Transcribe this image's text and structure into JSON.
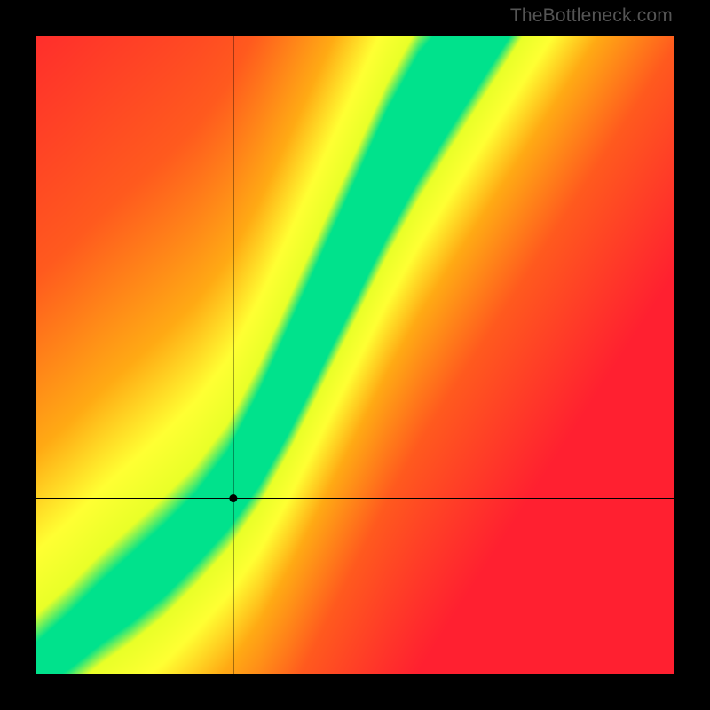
{
  "watermark": "TheBottleneck.com",
  "chart_data": {
    "type": "heatmap",
    "title": "",
    "xlabel": "",
    "ylabel": "",
    "xlim": [
      0,
      100
    ],
    "ylim": [
      0,
      100
    ],
    "crosshair": {
      "x": 30.9,
      "y": 27.5
    },
    "green_band": [
      {
        "x": 0.0,
        "lo": 0.0,
        "hi": 1.5
      },
      {
        "x": 5.0,
        "lo": 3.0,
        "hi": 6.0
      },
      {
        "x": 10.0,
        "lo": 7.0,
        "hi": 11.0
      },
      {
        "x": 15.0,
        "lo": 10.5,
        "hi": 15.5
      },
      {
        "x": 20.0,
        "lo": 14.5,
        "hi": 20.0
      },
      {
        "x": 25.0,
        "lo": 19.5,
        "hi": 25.0
      },
      {
        "x": 30.0,
        "lo": 25.0,
        "hi": 31.5
      },
      {
        "x": 35.0,
        "lo": 32.0,
        "hi": 41.0
      },
      {
        "x": 40.0,
        "lo": 41.0,
        "hi": 52.0
      },
      {
        "x": 45.0,
        "lo": 51.0,
        "hi": 63.0
      },
      {
        "x": 50.0,
        "lo": 61.0,
        "hi": 74.0
      },
      {
        "x": 55.0,
        "lo": 71.0,
        "hi": 85.0
      },
      {
        "x": 60.0,
        "lo": 80.0,
        "hi": 94.0
      },
      {
        "x": 65.0,
        "lo": 88.0,
        "hi": 100.0
      },
      {
        "x": 70.0,
        "lo": 95.0,
        "hi": 100.0
      }
    ],
    "colors": {
      "optimal": "#00e28c",
      "near": "#ffff33",
      "far": "#ff7a1a",
      "worst": "#ff2030"
    },
    "grid": false,
    "description": "Square heatmap with a diagonal green optimal band in the lower-left half curving upward, yellow near-band halo, orange-to-red gradient filling the rest. Black crosshair lines intersect at approximately (31, 28) in percent coordinates with a small black dot at the intersection."
  }
}
